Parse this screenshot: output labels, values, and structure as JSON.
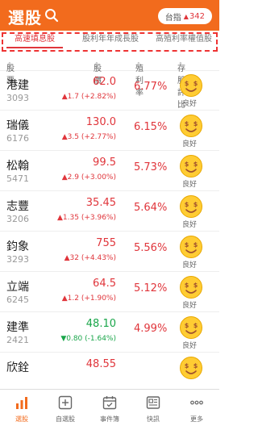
{
  "header": {
    "title": "選股",
    "index_label": "台指",
    "index_arrow": "▲",
    "index_value": "342"
  },
  "tabs": [
    {
      "label": "高速填息股",
      "active": true
    },
    {
      "label": "股利年年成長股",
      "active": false
    },
    {
      "label": "高殖利率權值股",
      "active": false
    }
  ],
  "columns": {
    "stock": "股票",
    "price": "股價",
    "yield": "殖利率",
    "rating": "存股評比"
  },
  "stocks": [
    {
      "name": "港建",
      "code": "3093",
      "price": "62.0",
      "change": "▲1.7 (+2.82%)",
      "dir": "up",
      "yield": "6.77%",
      "rating": "良好"
    },
    {
      "name": "瑞儀",
      "code": "6176",
      "price": "130.0",
      "change": "▲3.5 (+2.77%)",
      "dir": "up",
      "yield": "6.15%",
      "rating": "良好"
    },
    {
      "name": "松翰",
      "code": "5471",
      "price": "99.5",
      "change": "▲2.9 (+3.00%)",
      "dir": "up",
      "yield": "5.73%",
      "rating": "良好"
    },
    {
      "name": "志豐",
      "code": "3206",
      "price": "35.45",
      "change": "▲1.35 (+3.96%)",
      "dir": "up",
      "yield": "5.64%",
      "rating": "良好"
    },
    {
      "name": "鈞象",
      "code": "3293",
      "price": "755",
      "change": "▲32 (+4.43%)",
      "dir": "up",
      "yield": "5.56%",
      "rating": "良好"
    },
    {
      "name": "立端",
      "code": "6245",
      "price": "64.5",
      "change": "▲1.2 (+1.90%)",
      "dir": "up",
      "yield": "5.12%",
      "rating": "良好"
    },
    {
      "name": "建準",
      "code": "2421",
      "price": "48.10",
      "change": "▼0.80 (-1.64%)",
      "dir": "down",
      "yield": "4.99%",
      "rating": "良好"
    },
    {
      "name": "欣銓",
      "code": "",
      "price": "48.55",
      "change": "",
      "dir": "up",
      "yield": "",
      "rating": ""
    }
  ],
  "nav": [
    {
      "label": "選股",
      "icon": "bar-chart-icon",
      "active": true
    },
    {
      "label": "自選股",
      "icon": "plus-square-icon",
      "active": false
    },
    {
      "label": "事件簿",
      "icon": "calendar-icon",
      "active": false
    },
    {
      "label": "快訊",
      "icon": "news-icon",
      "active": false
    },
    {
      "label": "更多",
      "icon": "more-dots-icon",
      "active": false
    }
  ],
  "colors": {
    "brand": "#f26b1d",
    "up": "#e0353b",
    "down": "#1aa64a"
  }
}
